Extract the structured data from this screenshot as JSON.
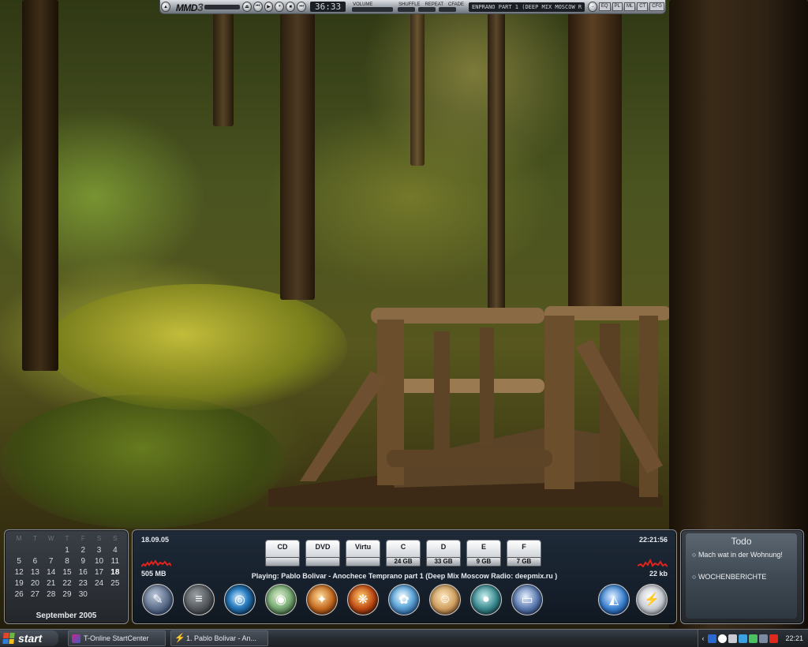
{
  "media_player": {
    "logo": "MMD",
    "logo_version": "3",
    "time": "36:33",
    "volume_label": "VOLUME",
    "shuffle_label": "SHUFFLE",
    "repeat_label": "REPEAT",
    "crossfade_label": "CFADE",
    "track": "ENPRANO PART 1 (DEEP MIX MOSCOW R",
    "tabs": [
      "EQ",
      "PL",
      "ML",
      "CT",
      "CFG"
    ]
  },
  "calendar": {
    "weekdays": [
      "M",
      "T",
      "W",
      "T",
      "F",
      "S",
      "S"
    ],
    "days": [
      "",
      "",
      "",
      "1",
      "2",
      "3",
      "4",
      "5",
      "6",
      "7",
      "8",
      "9",
      "10",
      "11",
      "12",
      "13",
      "14",
      "15",
      "16",
      "17",
      "18",
      "19",
      "20",
      "21",
      "22",
      "23",
      "24",
      "25",
      "26",
      "27",
      "28",
      "29",
      "30",
      "",
      ""
    ],
    "today": "18",
    "month_label": "September 2005"
  },
  "sysinfo": {
    "date": "18.09.05",
    "clock": "22:21:56",
    "memory": "505 MB",
    "network": "22 kb"
  },
  "drives": [
    {
      "name": "CD",
      "size": ""
    },
    {
      "name": "DVD",
      "size": ""
    },
    {
      "name": "Virtu",
      "size": ""
    },
    {
      "name": "C",
      "size": "24 GB"
    },
    {
      "name": "D",
      "size": "33 GB"
    },
    {
      "name": "E",
      "size": "9 GB"
    },
    {
      "name": "F",
      "size": "7 GB"
    }
  ],
  "now_playing": "Playing: Pablo Bolivar - Anochece Temprano part 1 (Deep Mix Moscow Radio:  deepmix.ru )",
  "todo": {
    "title": "Todo",
    "items": [
      "Mach wat in der Wohnung!",
      "WOCHENBERICHTE"
    ]
  },
  "taskbar": {
    "start_label": "start",
    "tasks": [
      "T-Online StartCenter",
      "1. Pablo Bolivar - An..."
    ],
    "clock": "22:21"
  },
  "colors": {
    "dock_panel": "#16202c",
    "taskbar": "#262b31",
    "sparkline": "#e0231c"
  }
}
